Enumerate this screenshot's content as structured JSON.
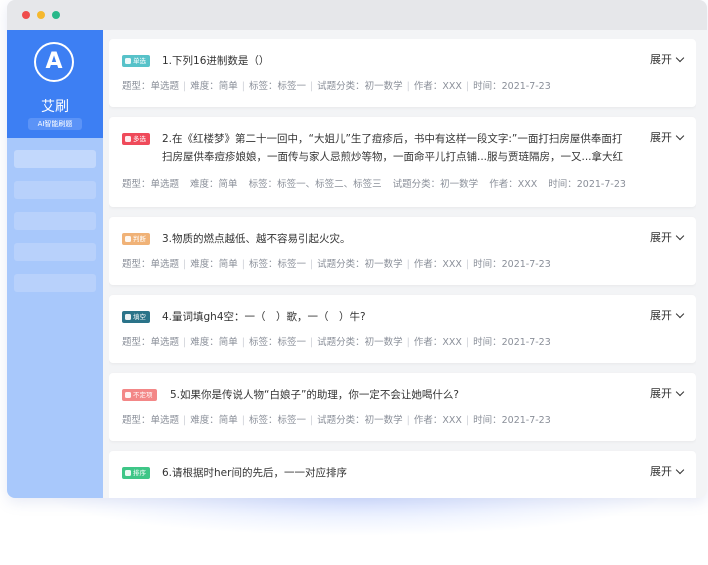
{
  "window": {
    "traffic_lights": [
      "#ef4c4c",
      "#f5b82e",
      "#28b88a"
    ]
  },
  "sidebar": {
    "logo_letter": "A",
    "app_name": "艾刷",
    "tag": "AI智能刷题",
    "accent": "#3d7ff3"
  },
  "questions": [
    {
      "badge": "单选",
      "badge_color": "#57c2c9",
      "badge_icon": "check-circle-icon",
      "text": "1.下列16进制数是（）",
      "expand": "展开",
      "meta": [
        "题型：单选题",
        "难度：简单",
        "标签：标签一",
        "试题分类：初一数学",
        "作者：XXX",
        "时间：2021-7-23"
      ]
    },
    {
      "badge": "多选",
      "badge_color": "#ef4a5a",
      "badge_icon": "multi-check-icon",
      "text": "2.在《红楼梦》第二十一回中，“大姐儿”生了痘疹后，书中有这样一段文字:”一面打扫房屋供奉面打扫房屋供奉痘疹娘娘，一面传与家人忌煎炒等物，一面命平儿打点铺...服与贾琏隔房，一又...拿大红",
      "expand": "展开",
      "meta": [
        "题型：单选题",
        "难度：简单",
        "标签：标签一、标签二、标签三",
        "试题分类：初一数学",
        "作者：XXX",
        "时间：2021-7-23"
      ]
    },
    {
      "badge": "判断",
      "badge_color": "#f0b277",
      "badge_icon": "judge-icon",
      "text": "3.物质的燃点越低、越不容易引起火灾。",
      "expand": "展开",
      "meta": [
        "题型：单选题",
        "难度：简单",
        "标签：标签一",
        "试题分类：初一数学",
        "作者：XXX",
        "时间：2021-7-23"
      ]
    },
    {
      "badge": "填空",
      "badge_color": "#2a7389",
      "badge_icon": "fill-blank-icon",
      "text": "4.量词填gh4空：一（　）歌，一（　）牛?",
      "expand": "展开",
      "meta": [
        "题型：单选题",
        "难度：简单",
        "标签：标签一",
        "试题分类：初一数学",
        "作者：XXX",
        "时间：2021-7-23"
      ]
    },
    {
      "badge": "不定项",
      "badge_color": "#f38787",
      "badge_icon": "uncertain-icon",
      "text": "5.如果你是传说人物“白娘子”的助理，你一定不会让她喝什么?",
      "expand": "展开",
      "meta": [
        "题型：单选题",
        "难度：简单",
        "标签：标签一",
        "试题分类：初一数学",
        "作者：XXX",
        "时间：2021-7-23"
      ]
    },
    {
      "badge": "排序",
      "badge_color": "#3ec687",
      "badge_icon": "star-icon",
      "text": "6.请根据时her间的先后，一一对应排序",
      "expand": "展开",
      "meta": []
    }
  ]
}
